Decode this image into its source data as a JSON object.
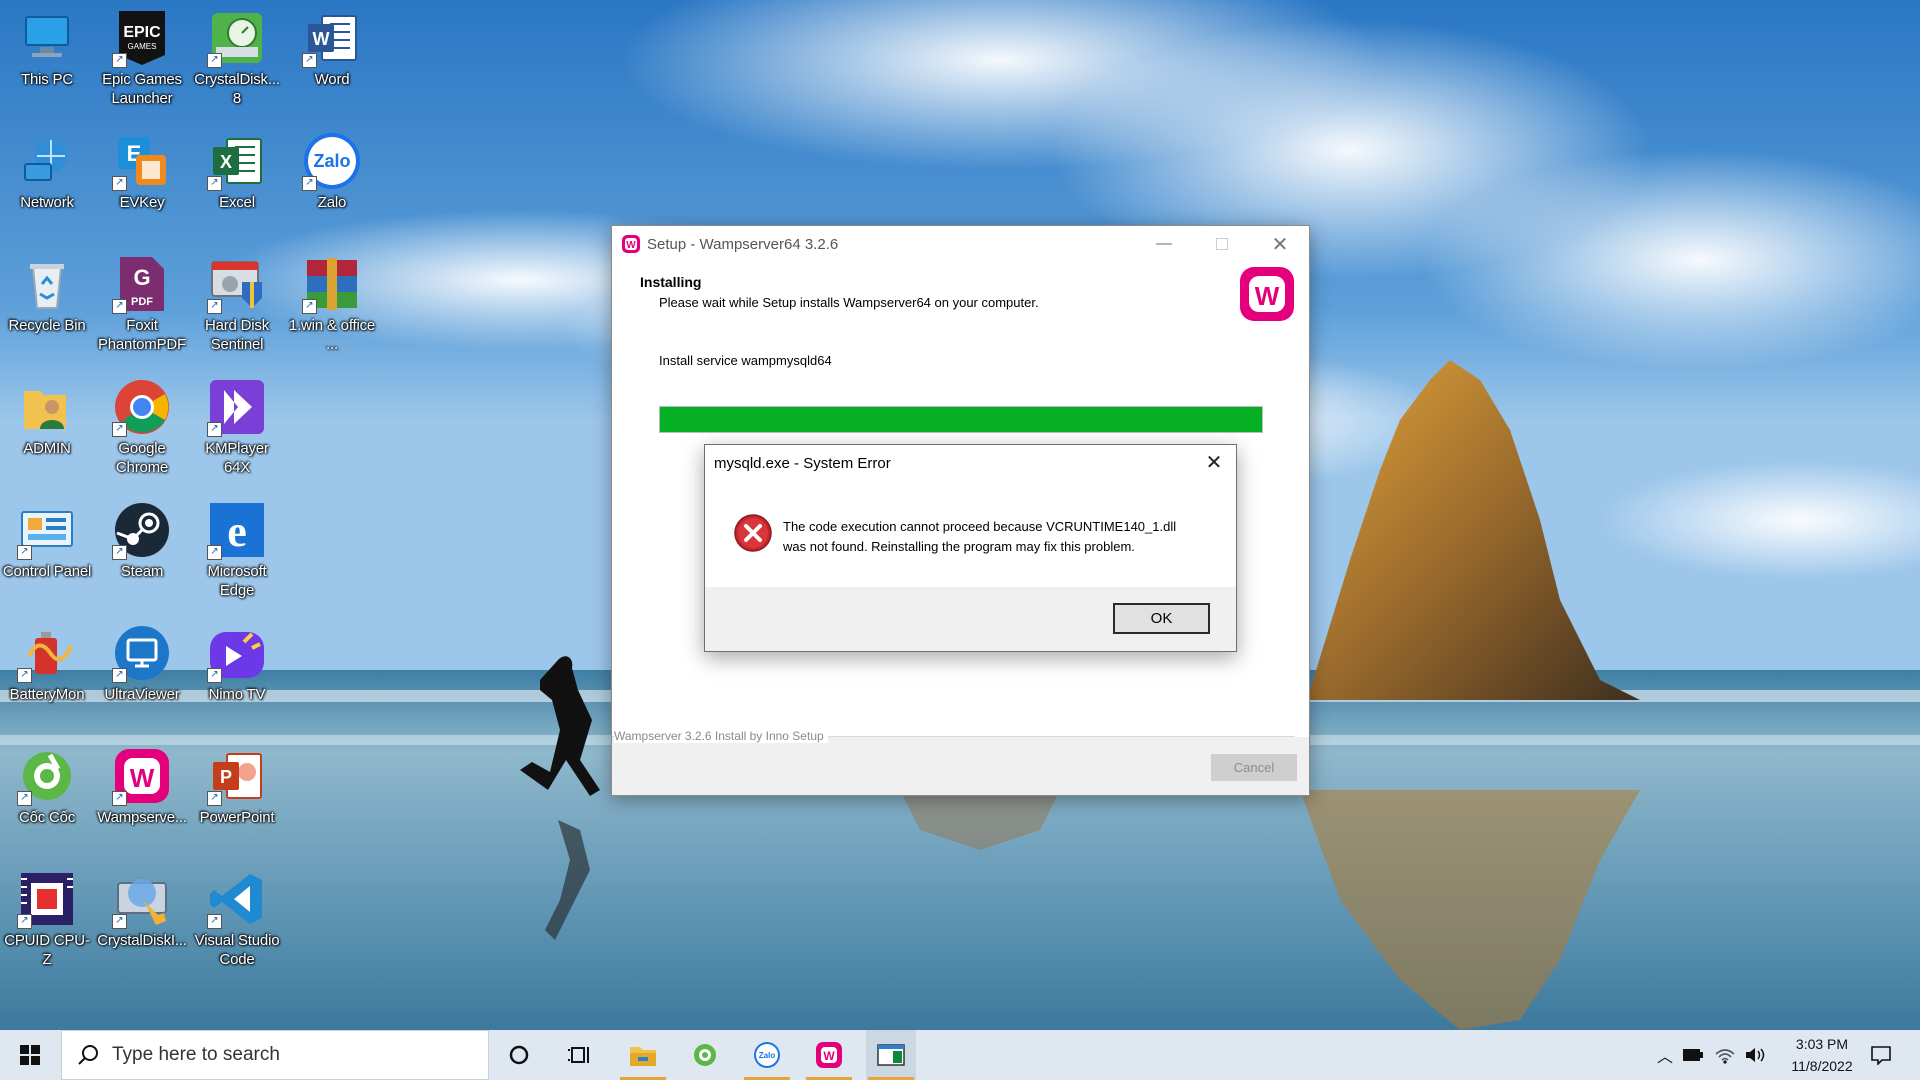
{
  "desktop": {
    "icons": [
      {
        "label": "This PC",
        "icon": "this-pc-icon"
      },
      {
        "label": "Epic Games Launcher",
        "icon": "epic-games-icon"
      },
      {
        "label": "CrystalDisk... 8",
        "icon": "crystaldisk-icon"
      },
      {
        "label": "Word",
        "icon": "word-icon"
      },
      {
        "label": "Network",
        "icon": "network-icon"
      },
      {
        "label": "EVKey",
        "icon": "evkey-icon"
      },
      {
        "label": "Excel",
        "icon": "excel-icon"
      },
      {
        "label": "Zalo",
        "icon": "zalo-icon"
      },
      {
        "label": "Recycle Bin",
        "icon": "recycle-bin-icon"
      },
      {
        "label": "Foxit PhantomPDF",
        "icon": "foxit-icon"
      },
      {
        "label": "Hard Disk Sentinel",
        "icon": "hard-disk-sentinel-icon"
      },
      {
        "label": "1.win & office ...",
        "icon": "winrar-icon"
      },
      {
        "label": "ADMIN",
        "icon": "user-folder-icon"
      },
      {
        "label": "Google Chrome",
        "icon": "chrome-icon"
      },
      {
        "label": "KMPlayer 64X",
        "icon": "kmplayer-icon"
      },
      {
        "label": "Control Panel",
        "icon": "control-panel-icon"
      },
      {
        "label": "Steam",
        "icon": "steam-icon"
      },
      {
        "label": "Microsoft Edge",
        "icon": "edge-icon"
      },
      {
        "label": "BatteryMon",
        "icon": "batterymon-icon"
      },
      {
        "label": "UltraViewer",
        "icon": "ultraviewer-icon"
      },
      {
        "label": "Nimo TV",
        "icon": "nimo-tv-icon"
      },
      {
        "label": "Cốc Cốc",
        "icon": "coccoc-icon"
      },
      {
        "label": "Wampserve...",
        "icon": "wampserver-icon"
      },
      {
        "label": "PowerPoint",
        "icon": "powerpoint-icon"
      },
      {
        "label": "CPUID CPU-Z",
        "icon": "cpuz-icon"
      },
      {
        "label": "CrystalDiskI...",
        "icon": "crystaldiskinfo-icon"
      },
      {
        "label": "Visual Studio Code",
        "icon": "vscode-icon"
      }
    ]
  },
  "setup_window": {
    "title": "Setup - Wampserver64 3.2.6",
    "heading": "Installing",
    "subheading": "Please wait while Setup installs Wampserver64 on your computer.",
    "status": "Install service wampmysqld64",
    "progress": 1.0,
    "footer_label": "Wampserver 3.2.6 Install by Inno Setup",
    "cancel_label": "Cancel",
    "accent_color": "#e4007c",
    "progress_color": "#06b025"
  },
  "error_dialog": {
    "title": "mysqld.exe - System Error",
    "message_line1": "The code execution cannot proceed because VCRUNTIME140_1.dll",
    "message_line2": "was not found. Reinstalling the program may fix this problem.",
    "ok_label": "OK",
    "icon": "error-icon"
  },
  "taskbar": {
    "search_placeholder": "Type here to search",
    "pinned": [
      "cortana-icon",
      "task-view-icon",
      "file-explorer-icon",
      "coccoc-icon",
      "zalo-icon",
      "wampserver-icon",
      "setup-window-icon"
    ],
    "time": "3:03 PM",
    "date": "11/8/2022"
  }
}
